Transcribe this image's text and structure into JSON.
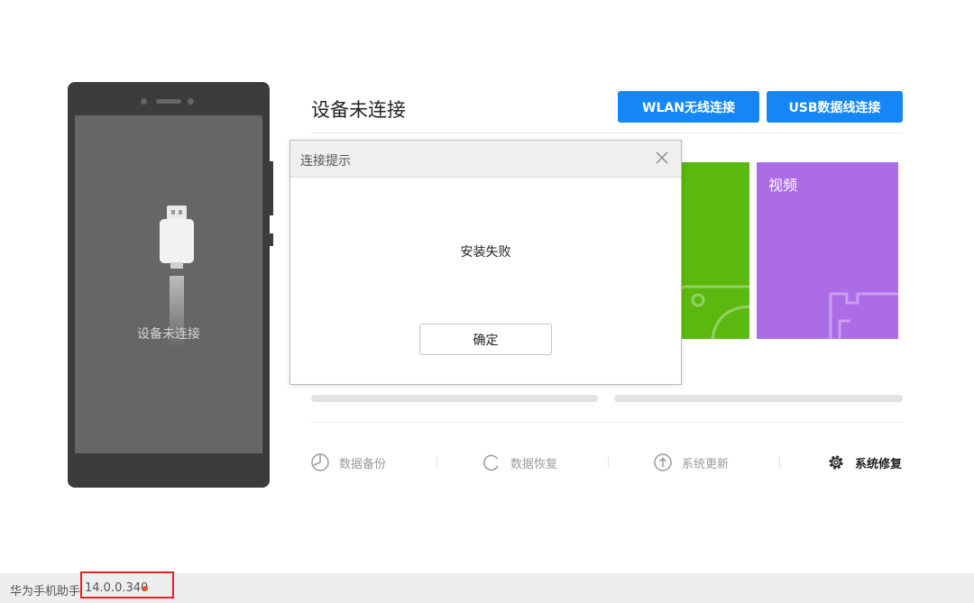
{
  "phone": {
    "status_text": "设备未连接"
  },
  "header": {
    "title": "设备未连接",
    "wlan_button": "WLAN无线连接",
    "usb_button": "USB数据线连接"
  },
  "tiles": {
    "green_label": "",
    "purple_label": "视频"
  },
  "actions": {
    "backup": "数据备份",
    "restore": "数据恢复",
    "update": "系统更新",
    "repair": "系统修复"
  },
  "dialog": {
    "title": "连接提示",
    "message": "安装失败",
    "ok_label": "确定"
  },
  "statusbar": {
    "app_name": "华为手机助手",
    "version": "14.0.0.340"
  },
  "colors": {
    "primary_button": "#1586f5",
    "green_tile": "#5ab80f",
    "purple_tile": "#ac6ce6",
    "highlight_box": "#e8202a",
    "status_dot": "#e8552a"
  },
  "icons": {
    "backup": "clock-pie-icon",
    "restore": "refresh-circle-icon",
    "update": "arrow-up-circle-icon",
    "repair": "gear-icon",
    "close": "close-icon",
    "usb": "usb-plug-icon"
  }
}
